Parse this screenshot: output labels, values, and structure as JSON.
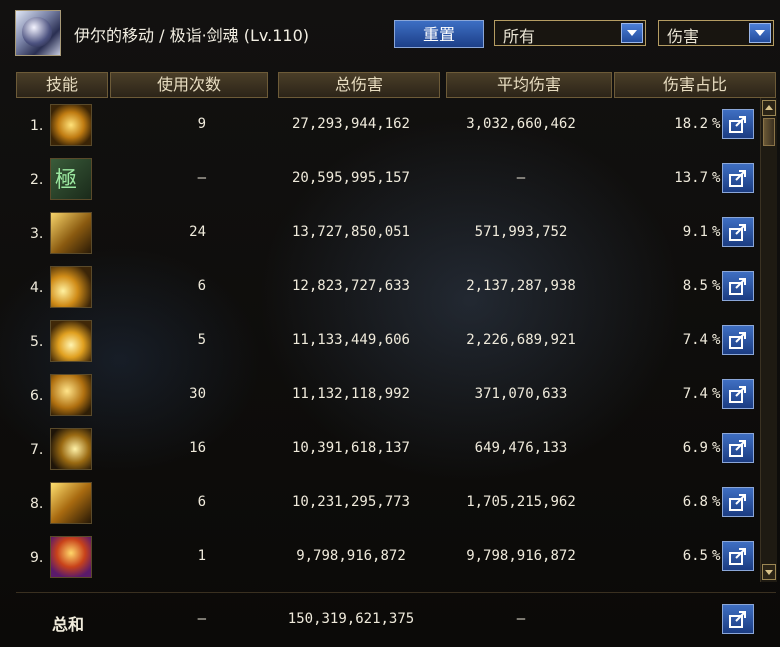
{
  "header": {
    "title": "伊尔的移动 / 极诣·剑魂 (Lv.110)",
    "reset_label": "重置",
    "filter_select": "所有",
    "metric_select": "伤害"
  },
  "columns": {
    "skill": "技能",
    "uses": "使用次数",
    "total": "总伤害",
    "average": "平均伤害",
    "share": "伤害占比"
  },
  "rows": [
    {
      "rank": "1.",
      "uses": "9",
      "total": "27,293,944,162",
      "average": "3,032,660,462",
      "pct": "18.2",
      "icon": "golden-slash-skill-icon"
    },
    {
      "rank": "2.",
      "uses": "–",
      "total": "20,595,995,157",
      "average": "–",
      "pct": "13.7",
      "icon": "awakening-glyph-skill-icon"
    },
    {
      "rank": "3.",
      "uses": "24",
      "total": "13,727,850,051",
      "average": "571,993,752",
      "pct": "9.1",
      "icon": "flowing-strike-skill-icon"
    },
    {
      "rank": "4.",
      "uses": "6",
      "total": "12,823,727,633",
      "average": "2,137,287,938",
      "pct": "8.5",
      "icon": "arc-slash-skill-icon"
    },
    {
      "rank": "5.",
      "uses": "5",
      "total": "11,133,449,606",
      "average": "2,226,689,921",
      "pct": "7.4",
      "icon": "burst-slash-skill-icon"
    },
    {
      "rank": "6.",
      "uses": "30",
      "total": "11,132,118,992",
      "average": "371,070,633",
      "pct": "7.4",
      "icon": "flowing-arc-skill-icon"
    },
    {
      "rank": "7.",
      "uses": "16",
      "total": "10,391,618,137",
      "average": "649,476,133",
      "pct": "6.9",
      "icon": "crescent-skill-icon"
    },
    {
      "rank": "8.",
      "uses": "6",
      "total": "10,231,295,773",
      "average": "1,705,215,962",
      "pct": "6.8",
      "icon": "blade-rush-skill-icon"
    },
    {
      "rank": "9.",
      "uses": "1",
      "total": "9,798,916,872",
      "average": "9,798,916,872",
      "pct": "6.5",
      "icon": "explosion-skill-icon"
    }
  ],
  "pct_sign": "%",
  "total_row": {
    "label": "总和",
    "uses": "–",
    "total": "150,319,621,375",
    "average": "–"
  },
  "colors": {
    "button_blue": "#2a55a8",
    "gold_border": "#b59d63",
    "text": "#efeadb"
  }
}
